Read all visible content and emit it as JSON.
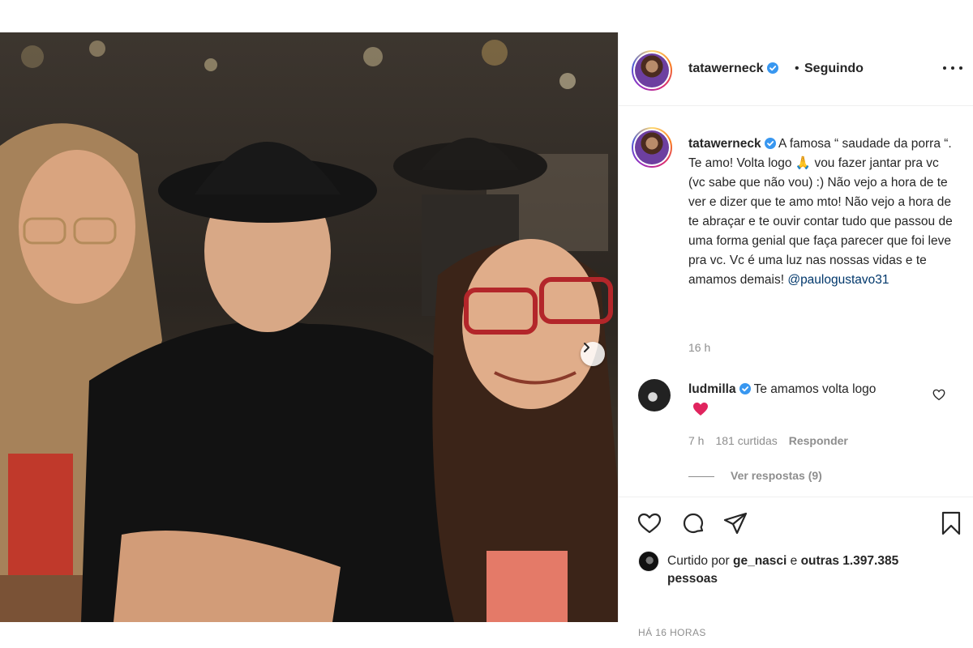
{
  "post": {
    "username": "tatawerneck",
    "follow_status": "Seguindo",
    "dot": "•"
  },
  "caption": {
    "username": "tatawerneck",
    "text_part1": " A famosa “ saudade da porra “. Te amo! Volta logo 🙏 vou fazer jantar pra vc (vc sabe que não vou) :) Não vejo a hora de te ver e dizer que te amo mto! Não vejo a hora de te abraçar e te ouvir contar tudo que passou de uma forma genial que faça parecer que foi leve pra vc. Vc é uma luz nas nossas vidas e te amamos demais! ",
    "mention": "@paulogustavo31",
    "time": "16 h"
  },
  "comment": {
    "username": "ludmilla",
    "text": " Te amamos volta logo",
    "time": "7 h",
    "likes": "181 curtidas",
    "reply_label": "Responder",
    "view_replies": "Ver respostas (9)"
  },
  "likes": {
    "prefix": "Curtido por ",
    "user": "ge_nasci",
    "middle": " e ",
    "others": "outras 1.397.385 pessoas"
  },
  "posted_time": "HÁ 16 HORAS",
  "icons": [
    "verified-badge-icon",
    "more-options-icon",
    "chevron-right-icon",
    "heart-icon",
    "comment-icon",
    "share-icon",
    "bookmark-icon",
    "red-heart-emoji-icon"
  ],
  "colors": {
    "verified": "#3897f0",
    "link": "#00376b",
    "secondary_text": "#8e8e8e",
    "red_heart": "#e0245e"
  }
}
